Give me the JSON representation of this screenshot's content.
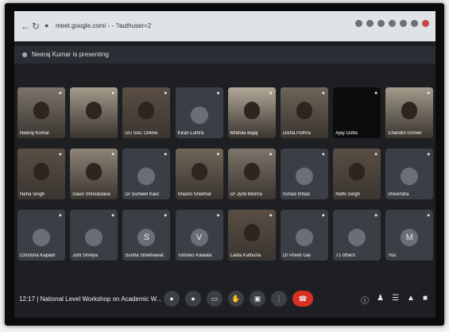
{
  "browser": {
    "url": "meet.google.com/ - - ?authuser=2"
  },
  "banner": {
    "text": "Neeraj Kumar is presenting"
  },
  "participants": [
    {
      "name": "Neeraj Kumar",
      "type": "video"
    },
    {
      "name": "",
      "type": "video"
    },
    {
      "name": "DU SoC Online",
      "type": "video"
    },
    {
      "name": "Kiran Luthra",
      "type": "avatar"
    },
    {
      "name": "Mridula Bajaj",
      "type": "video"
    },
    {
      "name": "Disha Puthra",
      "type": "video"
    },
    {
      "name": "Ajay Dutta",
      "type": "dark"
    },
    {
      "name": "Chandni Grover",
      "type": "video"
    },
    {
      "name": "Neha Singh",
      "type": "video"
    },
    {
      "name": "Gauri Shrivastava",
      "type": "video"
    },
    {
      "name": "Dr Sumeet Kaur",
      "type": "avatar"
    },
    {
      "name": "Shashi Shekhar",
      "type": "video"
    },
    {
      "name": "Dr Jyoti Mishra",
      "type": "video"
    },
    {
      "name": "Irshad Imtiaz",
      "type": "avatar"
    },
    {
      "name": "Nidhi Singh",
      "type": "video"
    },
    {
      "name": "shivendra",
      "type": "avatar"
    },
    {
      "name": "Christina Kapadi",
      "type": "avatar"
    },
    {
      "name": "Juhi Shreya",
      "type": "avatar"
    },
    {
      "name": "Sunita Shekhawat",
      "type": "initial",
      "initial": "S"
    },
    {
      "name": "Tomoko Kawata",
      "type": "initial",
      "initial": "V"
    },
    {
      "name": "Lalita Kathuria",
      "type": "video"
    },
    {
      "name": "Dr Preeti Gai",
      "type": "avatar"
    },
    {
      "name": "71 others",
      "type": "others"
    },
    {
      "name": "You",
      "type": "initial",
      "initial": "M"
    }
  ],
  "bottom": {
    "time": "12:17",
    "separator": "|",
    "meeting_title": "National Level Workshop on Academic W..."
  },
  "colors": {
    "end_call": "#d93025",
    "control_bg": "#3c4043"
  }
}
